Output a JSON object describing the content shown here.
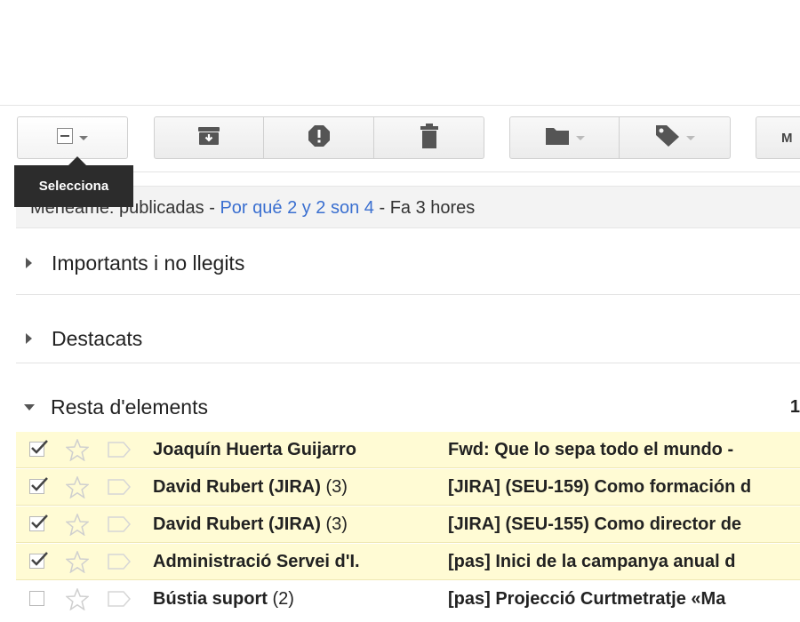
{
  "toolbar": {
    "select_tooltip": "Selecciona",
    "more_label": "M"
  },
  "webclip": {
    "source": "Menéame: publicadas",
    "sep1": " - ",
    "link": "Por qué 2 y 2 son 4",
    "sep2": " - ",
    "time": "Fa 3 hores"
  },
  "sections": {
    "important": "Importants i no llegits",
    "starred": "Destacats",
    "rest": "Resta d'elements",
    "rest_count": "1"
  },
  "messages": [
    {
      "sender": "Joaquín Huerta Guijarro",
      "thread_count": "",
      "subject": "Fwd: Que lo sepa todo el mundo -",
      "checked": true
    },
    {
      "sender": "David Rubert (JIRA)",
      "thread_count": "(3)",
      "subject": "[JIRA] (SEU-159) Como formación d",
      "checked": true
    },
    {
      "sender": "David Rubert (JIRA)",
      "thread_count": "(3)",
      "subject": "[JIRA] (SEU-155) Como director de",
      "checked": true
    },
    {
      "sender": "Administració Servei d'I.",
      "thread_count": "",
      "subject": "[pas] Inici de la campanya anual d",
      "checked": true
    },
    {
      "sender": "Bústia suport",
      "thread_count": "(2)",
      "subject": "[pas] Projecció Curtmetratje «Ma",
      "checked": false
    }
  ],
  "colors": {
    "selected_row": "#fffbd4",
    "link": "#3a6fd0",
    "tooltip_bg": "#2c2c2c"
  }
}
